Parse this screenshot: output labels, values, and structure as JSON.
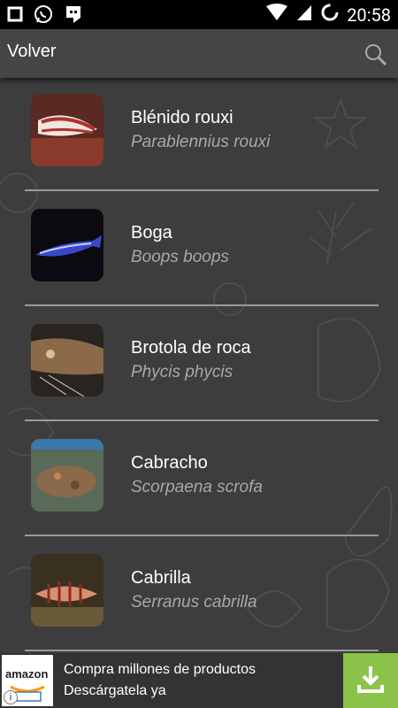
{
  "status_bar": {
    "time": "20:58"
  },
  "action_bar": {
    "back_label": "Volver"
  },
  "species": [
    {
      "name": "Blénido rouxi",
      "scientific": "Parablennius rouxi"
    },
    {
      "name": "Boga",
      "scientific": "Boops boops"
    },
    {
      "name": "Brotola de roca",
      "scientific": "Phycis phycis"
    },
    {
      "name": "Cabracho",
      "scientific": "Scorpaena scrofa"
    },
    {
      "name": "Cabrilla",
      "scientific": "Serranus cabrilla"
    }
  ],
  "ad": {
    "brand": "amazon",
    "line1": "Compra millones de productos",
    "line2": "Descárgatela ya",
    "info": "i",
    "accent": "#8bc34a"
  },
  "colors": {
    "background": "#404040",
    "action_bar": "#454545",
    "secondary_text": "#a8a8a8"
  }
}
